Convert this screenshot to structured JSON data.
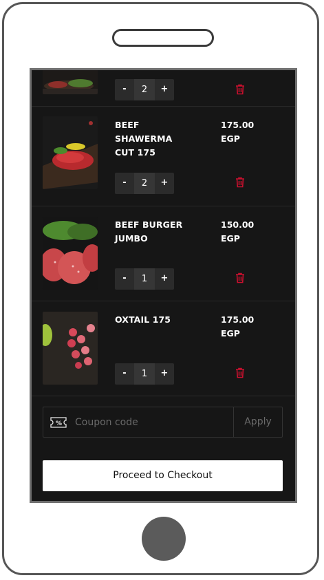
{
  "cart": {
    "items": [
      {
        "name": "",
        "price": "",
        "qty": "2"
      },
      {
        "name": "BEEF\nSHAWERMA\nCUT  175",
        "price": "175.00\nEGP",
        "qty": "2"
      },
      {
        "name": "BEEF BURGER\nJUMBO",
        "price": "150.00\nEGP",
        "qty": "1"
      },
      {
        "name": "OXTAIL 175",
        "price": "175.00\nEGP",
        "qty": "1"
      }
    ],
    "minus_label": "-",
    "plus_label": "+"
  },
  "coupon": {
    "placeholder": "Coupon code",
    "apply_label": "Apply"
  },
  "checkout": {
    "label": "Proceed to Checkout"
  },
  "colors": {
    "background": "#161616",
    "trash": "#c8102e",
    "text": "#ffffff",
    "muted": "#6a6a6a"
  },
  "icons": [
    "trash-icon",
    "coupon-icon"
  ]
}
